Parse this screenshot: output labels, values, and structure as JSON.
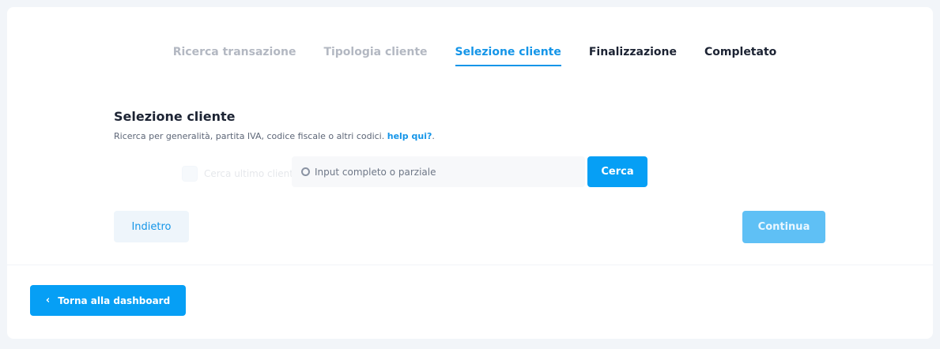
{
  "steps": [
    {
      "label": "Ricerca transazione"
    },
    {
      "label": "Tipologia cliente"
    },
    {
      "label": "Selezione cliente"
    },
    {
      "label": "Finalizzazione"
    },
    {
      "label": "Completato"
    }
  ],
  "section": {
    "title": "Selezione cliente",
    "subtitle": "Ricerca per generalità, partita IVA, codice fiscale o altri codici.",
    "help_link": "help qui?",
    "help_suffix": "."
  },
  "search": {
    "placeholder": "Input completo o parziale",
    "button_label": "Cerca",
    "faded_option_label": "Cerca ultimo cliente"
  },
  "actions": {
    "back_label": "Indietro",
    "continue_label": "Continua",
    "dashboard_label": "Torna alla dashboard"
  },
  "icons": {
    "search": "search-icon",
    "back": "chevron-left-icon"
  },
  "colors": {
    "accent": "#069ff5",
    "accent_text": "#1495e8",
    "continue_disabled": "#5fc0f5"
  }
}
